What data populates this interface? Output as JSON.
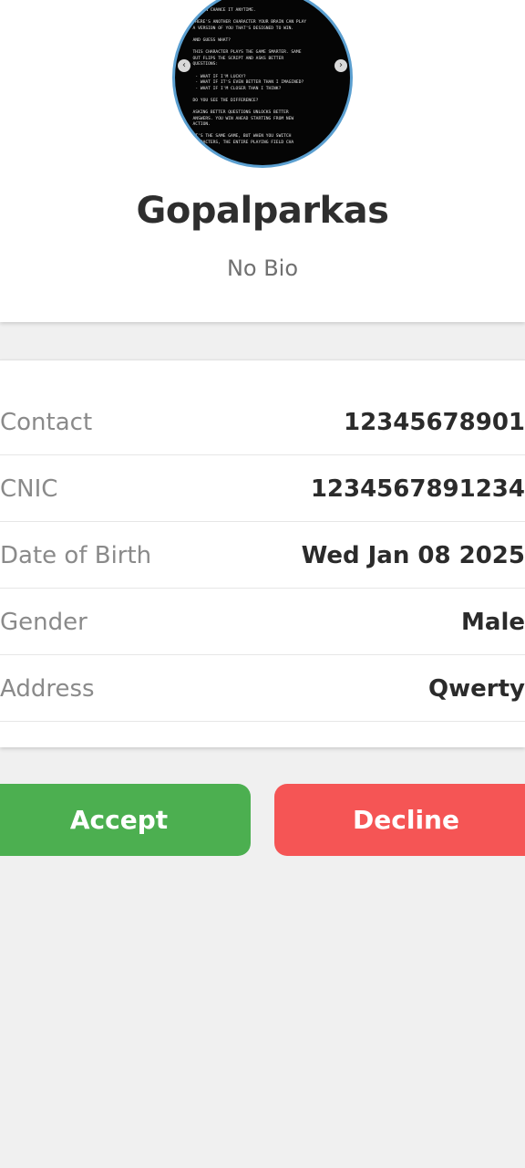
{
  "profile": {
    "name": "Gopalparkas",
    "bio": "No Bio",
    "avatar_text": "      ON CHANCE IT ANYTIME.\n\n  THERE'S ANOTHER CHARACTER YOUR BRAIN CAN PLAY\n  A VERSION OF YOU THAT'S DESIGNED TO WIN.\n\n  AND GUESS WHAT?\n\n  THIS CHARACTER PLAYS THE GAME SMARTER. SAME\n  OUT FLIPS THE SCRIPT AND ASKS BETTER\n  QUESTIONS:\n\n   - WHAT IF I'M LUCKY?\n   - WHAT IF IT'S EVEN BETTER THAN I IMAGINED?\n   - WHAT IF I'M CLOSER THAN I THINK?\n\n  DO YOU SEE THE DIFFERENCE?\n\n  ASKING BETTER QUESTIONS UNLOCKS BETTER\n  ANSWERS. YOU WIN AHEAD STARTING FROM NEW\n  ACTION.\n\n  IT'S THE SAME GAME, BUT WHEN YOU SWITCH\n  CHARACTERS, THE ENTIRE PLAYING FIELD CHA"
  },
  "details": [
    {
      "label": "Contact",
      "value": "12345678901"
    },
    {
      "label": "CNIC",
      "value": "1234567891234"
    },
    {
      "label": "Date of Birth",
      "value": "Wed Jan 08 2025"
    },
    {
      "label": "Gender",
      "value": "Male"
    },
    {
      "label": "Address",
      "value": "Qwerty"
    }
  ],
  "actions": {
    "accept_label": "Accept",
    "decline_label": "Decline"
  },
  "colors": {
    "accept": "#4caf50",
    "decline": "#f55555",
    "avatar_border": "#5b9fd0"
  },
  "icons": {
    "avatar_prev": "chevron-left-icon",
    "avatar_next": "chevron-right-icon"
  }
}
